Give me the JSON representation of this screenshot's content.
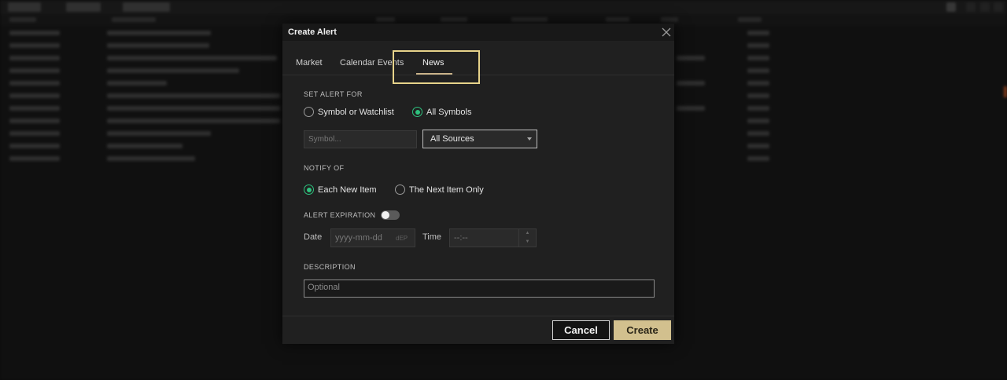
{
  "dialog": {
    "title": "Create Alert",
    "tabs": [
      {
        "label": "Market"
      },
      {
        "label": "Calendar Events"
      },
      {
        "label": "News",
        "active": true
      }
    ],
    "set_alert_for": {
      "label": "SET ALERT FOR",
      "options": [
        {
          "label": "Symbol or Watchlist",
          "checked": false
        },
        {
          "label": "All Symbols",
          "checked": true
        }
      ],
      "symbol_placeholder": "Symbol...",
      "source_value": "All Sources"
    },
    "notify_of": {
      "label": "NOTIFY OF",
      "options": [
        {
          "label": "Each New Item",
          "checked": true
        },
        {
          "label": "The Next Item Only",
          "checked": false
        }
      ]
    },
    "expiration": {
      "label": "ALERT EXPIRATION",
      "enabled": false,
      "date_label": "Date",
      "date_placeholder": "yyyy-mm-dd",
      "date_suffix": "dEP",
      "time_label": "Time",
      "time_placeholder": "--:--"
    },
    "description": {
      "label": "DESCRIPTION",
      "placeholder": "Optional"
    },
    "buttons": {
      "cancel": "Cancel",
      "create": "Create"
    }
  },
  "colors": {
    "accent": "#d2c08e",
    "radio_checked": "#2ec27e",
    "highlight": "#e7d38a"
  }
}
